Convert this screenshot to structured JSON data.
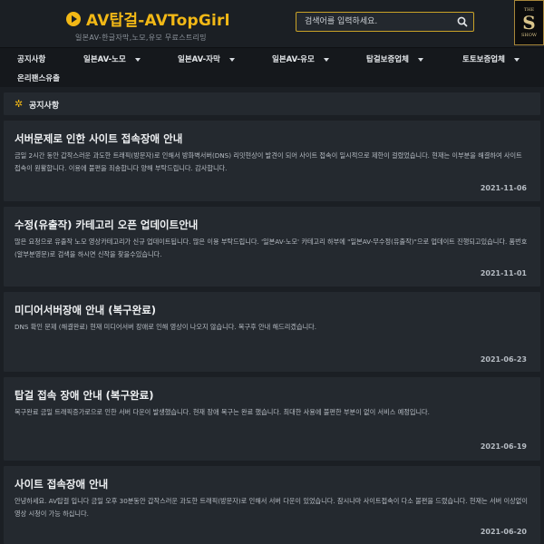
{
  "header": {
    "site_name": "AV탑걸-AVTopGirl",
    "tagline": "일본AV-한글자막,노모,유모 무료스트리밍",
    "search_placeholder": "검색어를 입력하세요.",
    "badge_top": "THE",
    "badge_letter": "S",
    "badge_bottom": "SHOW"
  },
  "nav": {
    "items": [
      {
        "label": "공지사항"
      },
      {
        "label": "일본AV-노모"
      },
      {
        "label": "일본AV-자막"
      },
      {
        "label": "일본AV-유모"
      },
      {
        "label": "탑걸보증업체"
      },
      {
        "label": "토토보증업체"
      },
      {
        "label": "온리팬스유출"
      }
    ]
  },
  "notice": {
    "title": "공지사항",
    "icon": "sun-icon"
  },
  "posts": [
    {
      "title": "서버문제로 인한 사이트 접속장애 안내",
      "body": "금일 2시간 동안 갑작스러운 과도한 트래픽(방문자)로 인해서 방화벽서버(DNS) 리밋현상이 발견이 되어 사이트 접속이 일시적으로 제한이 걸렸었습니다. 현재는 이부분을 해결하여 사이트 접속이 원활합니다. 이용에 불편을 죄송합니다 양해 부탁드립니다. 감사합니다.",
      "date": "2021-11-06"
    },
    {
      "title": "수정(유출작) 카테고리 오픈 업데이트안내",
      "body": "많은 요청으로 유출작 노모 영상카테고리가 신규 업데이트됩니다. 많은 이용 부탁드립니다. '일본AV-노모' 카테고리 하부에 \"일본AV-무수정(유출작)\"으로 업데이트 진행되고있습니다. 품번호(알부분영문)로 검색을 하시면 신작을 찾을수있습니다.",
      "date": "2021-11-01"
    },
    {
      "title": "미디어서버장애 안내 (복구완료)",
      "body": "DNS 확인 문제 (해결완료) 현재 미디어서버 장애로 인해 영상이 나오지 않습니다. 복구후 안내 해드리겠습니다.",
      "date": "2021-06-23"
    },
    {
      "title": "탑걸 접속 장애 안내 (복구완료)",
      "body": "복구완료 금일 트래픽증가로으로 인한 서버 다운이 발생했습니다. 현재 장애 복구는 완료 했습니다. 최대한 사용에 불편한 부분이 없이 서비스 예정입니다.",
      "date": "2021-06-19"
    },
    {
      "title": "사이트 접속장애 안내",
      "body": "안녕하세요. AV탑걸 입니다 금일 오후 30분동안 갑작스러운 과도한 트래픽(방문자)로 인해서 서버 다운이 있었습니다. 잠시나마 사이트접속이 다소 불편을 드렸습니다. 현재는 서버 이상없이 영상 시청이 가능 하십니다.",
      "date": "2021-06-20"
    }
  ]
}
